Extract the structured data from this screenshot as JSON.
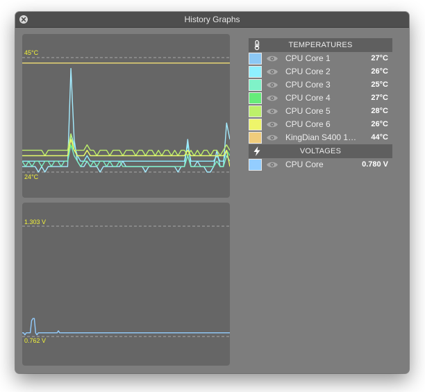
{
  "window": {
    "title": "History Graphs"
  },
  "temperature_graph": {
    "max_label": "45°C",
    "min_label": "24°C",
    "range": [
      24,
      45
    ],
    "threshold": 44,
    "series": [
      {
        "name": "CPU Core 1",
        "color": "#a4ecff",
        "values": [
          25,
          25,
          25,
          25,
          25,
          24,
          25,
          24,
          25,
          25,
          25,
          25,
          25,
          25,
          25,
          43,
          30,
          26,
          25,
          25,
          26,
          25,
          25,
          25,
          24,
          25,
          25,
          25,
          25,
          25,
          25,
          26,
          25,
          25,
          25,
          25,
          25,
          25,
          24,
          25,
          25,
          25,
          25,
          25,
          25,
          25,
          25,
          25,
          24,
          25,
          25,
          30,
          25,
          25,
          26,
          25,
          25,
          24,
          24,
          25,
          28,
          25,
          25,
          33,
          30
        ]
      },
      {
        "name": "CPU Core 2",
        "color": "#8ff0ff",
        "values": [
          26,
          26,
          26,
          26,
          26,
          26,
          26,
          26,
          26,
          26,
          26,
          26,
          26,
          26,
          26,
          31,
          29,
          27,
          26,
          26,
          27,
          26,
          26,
          26,
          26,
          26,
          26,
          26,
          26,
          26,
          26,
          26,
          26,
          26,
          26,
          26,
          26,
          26,
          26,
          26,
          26,
          26,
          26,
          26,
          26,
          26,
          26,
          26,
          26,
          26,
          26,
          29,
          26,
          26,
          26,
          26,
          26,
          26,
          26,
          26,
          27,
          26,
          26,
          28,
          27
        ]
      },
      {
        "name": "CPU Core 3",
        "color": "#7ff2c8",
        "values": [
          26,
          25,
          26,
          25,
          26,
          26,
          25,
          26,
          26,
          25,
          26,
          26,
          25,
          26,
          26,
          29,
          27,
          26,
          25,
          26,
          26,
          25,
          26,
          25,
          26,
          26,
          25,
          26,
          25,
          25,
          26,
          25,
          25,
          25,
          25,
          25,
          25,
          25,
          25,
          25,
          25,
          25,
          25,
          25,
          25,
          25,
          25,
          25,
          25,
          25,
          25,
          27,
          25,
          25,
          25,
          25,
          25,
          25,
          25,
          25,
          26,
          25,
          25,
          27,
          26
        ]
      },
      {
        "name": "CPU Core 4",
        "color": "#66ec7a",
        "values": [
          27,
          27,
          27,
          27,
          27,
          27,
          27,
          27,
          27,
          27,
          27,
          27,
          27,
          27,
          27,
          29,
          28,
          27,
          27,
          27,
          28,
          27,
          27,
          27,
          27,
          27,
          27,
          27,
          27,
          27,
          27,
          27,
          27,
          27,
          27,
          27,
          27,
          27,
          27,
          27,
          27,
          27,
          27,
          27,
          27,
          27,
          27,
          27,
          27,
          27,
          27,
          28,
          27,
          27,
          27,
          27,
          27,
          27,
          27,
          27,
          27,
          27,
          27,
          28,
          27
        ]
      },
      {
        "name": "CPU Core 5",
        "color": "#bdf06a",
        "values": [
          28,
          28,
          28,
          28,
          28,
          28,
          28,
          27,
          28,
          28,
          28,
          28,
          28,
          28,
          28,
          31,
          28,
          28,
          28,
          28,
          29,
          28,
          28,
          27,
          28,
          28,
          28,
          27,
          28,
          28,
          28,
          27,
          28,
          28,
          28,
          27,
          28,
          28,
          27,
          28,
          28,
          27,
          28,
          27,
          28,
          28,
          27,
          28,
          27,
          28,
          28,
          27,
          28,
          27,
          28,
          27,
          28,
          28,
          27,
          28,
          28,
          27,
          28,
          29,
          28
        ]
      },
      {
        "name": "CPU Core 6",
        "color": "#eef56a",
        "values": [
          27,
          27,
          27,
          27,
          27,
          27,
          27,
          27,
          27,
          27,
          27,
          27,
          27,
          27,
          27,
          30,
          28,
          27,
          27,
          27,
          28,
          27,
          27,
          27,
          27,
          27,
          27,
          27,
          27,
          27,
          27,
          27,
          27,
          27,
          27,
          27,
          27,
          27,
          27,
          27,
          27,
          27,
          27,
          27,
          27,
          27,
          27,
          27,
          27,
          27,
          27,
          28,
          27,
          27,
          27,
          27,
          27,
          27,
          27,
          27,
          27,
          27,
          27,
          28,
          25
        ]
      }
    ]
  },
  "voltage_graph": {
    "max_label": "1.303 V",
    "min_label": "0.762 V",
    "range": [
      0.762,
      1.303
    ],
    "series": [
      {
        "name": "CPU Core",
        "color": "#93cdff",
        "values": [
          0.78,
          0.78,
          0.77,
          0.78,
          0.78,
          0.78,
          0.78,
          0.84,
          0.85,
          0.85,
          0.78,
          0.77,
          0.78,
          0.78,
          0.78,
          0.78,
          0.78,
          0.78,
          0.78,
          0.78,
          0.78,
          0.78,
          0.78,
          0.78,
          0.78,
          0.78,
          0.78,
          0.79,
          0.78,
          0.78,
          0.78,
          0.78,
          0.78,
          0.78,
          0.78,
          0.78,
          0.78,
          0.78,
          0.78,
          0.78,
          0.78,
          0.78,
          0.78,
          0.78,
          0.78,
          0.78,
          0.78,
          0.78,
          0.78,
          0.78,
          0.78,
          0.78,
          0.78,
          0.78,
          0.78,
          0.78,
          0.78,
          0.78,
          0.78,
          0.78,
          0.78,
          0.78,
          0.78,
          0.78,
          0.78,
          0.78,
          0.78,
          0.78,
          0.78,
          0.78,
          0.78,
          0.78,
          0.78,
          0.78,
          0.78,
          0.78,
          0.78,
          0.78,
          0.78,
          0.78,
          0.78,
          0.78,
          0.78,
          0.78,
          0.78,
          0.78,
          0.78,
          0.78,
          0.78,
          0.78,
          0.78,
          0.78,
          0.78,
          0.78,
          0.78,
          0.78,
          0.78,
          0.78,
          0.78,
          0.78,
          0.78,
          0.78,
          0.78,
          0.78,
          0.78,
          0.78,
          0.78,
          0.78,
          0.78,
          0.78,
          0.78,
          0.78,
          0.78,
          0.78,
          0.78,
          0.78,
          0.78,
          0.78,
          0.78,
          0.78,
          0.78,
          0.78,
          0.78,
          0.78,
          0.78,
          0.78,
          0.78,
          0.78,
          0.78,
          0.78,
          0.78,
          0.78,
          0.78,
          0.78,
          0.78,
          0.78,
          0.78,
          0.78,
          0.78,
          0.78,
          0.78,
          0.78,
          0.78,
          0.78,
          0.78,
          0.78,
          0.78,
          0.78,
          0.78,
          0.78,
          0.78,
          0.78,
          0.78,
          0.78,
          0.78,
          0.78
        ]
      }
    ]
  },
  "sections": [
    {
      "title": "TEMPERATURES",
      "icon": "thermometer-icon",
      "rows": [
        {
          "label": "CPU Core 1",
          "value": "27°C",
          "color": "#8cc8f5"
        },
        {
          "label": "CPU Core 2",
          "value": "26°C",
          "color": "#8ff0ff"
        },
        {
          "label": "CPU Core 3",
          "value": "25°C",
          "color": "#7ff2c8"
        },
        {
          "label": "CPU Core 4",
          "value": "27°C",
          "color": "#66ec7a"
        },
        {
          "label": "CPU Core 5",
          "value": "28°C",
          "color": "#bdf06a"
        },
        {
          "label": "CPU Core 6",
          "value": "26°C",
          "color": "#eef56a"
        },
        {
          "label": "KingDian S400 1…",
          "value": "44°C",
          "color": "#f0cc7c"
        }
      ]
    },
    {
      "title": "VOLTAGES",
      "icon": "lightning-icon",
      "rows": [
        {
          "label": "CPU Core",
          "value": "0.780 V",
          "color": "#93cdff"
        }
      ]
    }
  ]
}
